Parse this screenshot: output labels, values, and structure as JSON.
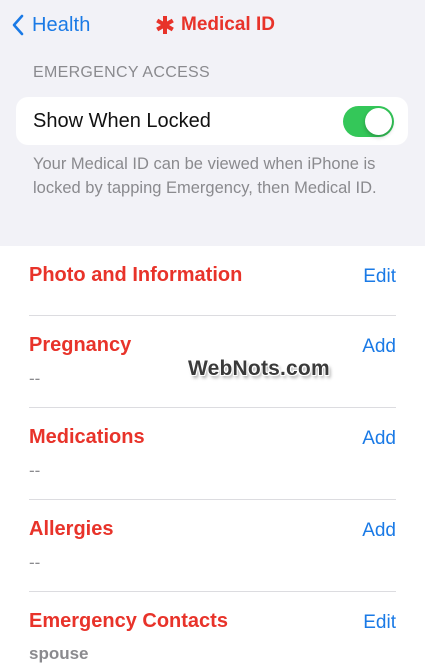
{
  "nav": {
    "back_label": "Health",
    "title": "Medical ID"
  },
  "emergency_access": {
    "header": "EMERGENCY ACCESS",
    "toggle_label": "Show When Locked",
    "toggle_on": true,
    "footnote": "Your Medical ID can be viewed when iPhone is locked by tapping Emergency, then Medical ID."
  },
  "sections": [
    {
      "title": "Photo and Information",
      "action": "Edit",
      "value": ""
    },
    {
      "title": "Pregnancy",
      "action": "Add",
      "value": "--"
    },
    {
      "title": "Medications",
      "action": "Add",
      "value": "--"
    },
    {
      "title": "Allergies",
      "action": "Add",
      "value": "--"
    },
    {
      "title": "Emergency Contacts",
      "action": "Edit",
      "value": "spouse"
    }
  ],
  "watermark": "WebNots.com",
  "colors": {
    "accent_red": "#e8332a",
    "link_blue": "#1a7ae6",
    "toggle_green": "#34c759",
    "secondary_text": "#8a8a8e",
    "background": "#f2f2f7"
  },
  "icons": {
    "back": "chevron-left-icon",
    "title": "medical-asterisk-icon"
  }
}
